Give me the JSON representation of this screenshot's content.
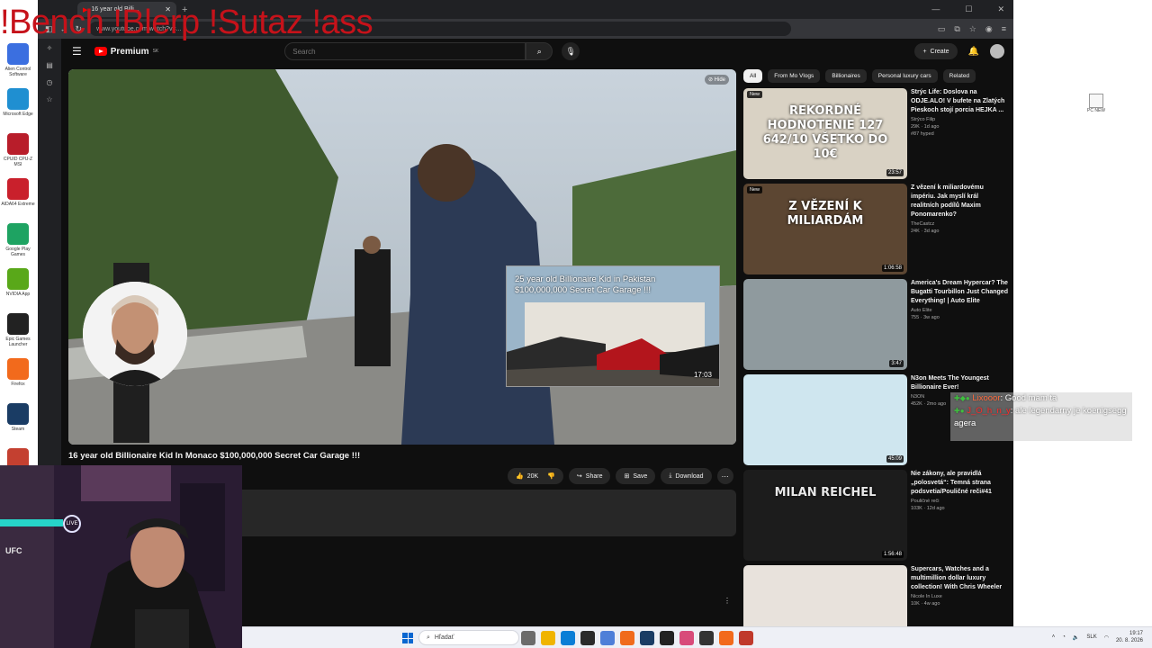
{
  "overlay_text": "!Bench !Blerp !Sutaz !ass",
  "desktop_icons": [
    {
      "label": "Alien Control Software",
      "icon": "app-icon",
      "color": "#3b6fe0"
    },
    {
      "label": "Microsoft Edge",
      "icon": "edge-icon",
      "color": "#1f8fd1"
    },
    {
      "label": "CPUID CPU-Z MSI",
      "icon": "cpuz-icon",
      "color": "#b81d2a"
    },
    {
      "label": "AIDA64 Extreme",
      "icon": "aida64-icon",
      "color": "#c9202c"
    },
    {
      "label": "Google Play Games",
      "icon": "google-play-icon",
      "color": "#1ea362"
    },
    {
      "label": "NVIDIA App",
      "icon": "nvidia-icon",
      "color": "#59a819"
    },
    {
      "label": "Epic Games Launcher",
      "icon": "epic-games-icon",
      "color": "#222222"
    },
    {
      "label": "Firefox",
      "icon": "firefox-icon",
      "color": "#f26a1c"
    },
    {
      "label": "Steam",
      "icon": "steam-icon",
      "color": "#1a3c64"
    },
    {
      "label": "",
      "icon": "app-icon",
      "color": "#c44030"
    }
  ],
  "browser": {
    "tab_title": "16 year old Billi...",
    "url": "www.youtube.com/watch?v=...",
    "new_tab": "+"
  },
  "youtube": {
    "logo_text": "Premium",
    "logo_sup": "SK",
    "search_placeholder": "Search",
    "create_label": "Create",
    "player": {
      "hide_label": "Hide",
      "endcard_title": "25 year old Billionaire Kid in Pakistan $100,000,000 Secret Car Garage !!!",
      "endcard_duration": "17:03"
    },
    "video_title": "16 year old Billionaire Kid In Monaco $100,000,000 Secret Car Garage !!!",
    "actions": {
      "likes": "20K",
      "share": "Share",
      "save": "Save",
      "download": "Download"
    },
    "chips": [
      "All",
      "From Mo Vlogs",
      "Billionaires",
      "Personal luxury cars",
      "Related"
    ],
    "recommendations": [
      {
        "title": "Strýc Life: Doslova na ODJE.ALO! V bufete na Zlatých Pieskoch stojí porcia HEJKA ...",
        "channel": "Strýco Filip",
        "stats": "29K · 1d ago",
        "extra": "#87 hyped",
        "duration": "23:57",
        "new": "New",
        "thumb_text": "REKORDNÉ HODNOTENIE 127 642/10 VŠETKO DO 10€",
        "bg": "#d9d2c4"
      },
      {
        "title": "Z vězení k miliardovému impériu. Jak myslí král realitních podílů Maxim Ponomarenko?",
        "channel": "TheCastcz",
        "stats": "24K · 3d ago",
        "extra": "",
        "duration": "1:06:58",
        "new": "New",
        "thumb_text": "Z VĚZENÍ K MILIARDÁM",
        "bg": "#5c4632"
      },
      {
        "title": "America's Dream Hypercar? The Bugatti Tourbillon Just Changed Everything! | Auto Elite",
        "channel": "Auto Elite",
        "stats": "755 · 3w ago",
        "extra": "",
        "duration": "3:47",
        "new": "",
        "thumb_text": "",
        "bg": "#8f9a9e"
      },
      {
        "title": "N3on Meets The Youngest Billionaire Ever!",
        "channel": "N3ON",
        "stats": "452K · 2mo ago",
        "extra": "",
        "duration": "45:09",
        "new": "",
        "thumb_text": "",
        "bg": "#cfe6ef"
      },
      {
        "title": "Nie zákony, ale pravidlá „polosvetá“: Temná strana podsvetia/Pouličné reči#41",
        "channel": "Pouličné reči",
        "stats": "103K · 12d ago",
        "extra": "",
        "duration": "1:56:48",
        "new": "",
        "thumb_text": "MILAN REICHEL",
        "bg": "#1c1c1c"
      },
      {
        "title": "Supercars, Watches and a multimillion dollar luxury collection! With Chris Wheeler",
        "channel": "Nicole In Luxe",
        "stats": "10K · 4w ago",
        "extra": "",
        "duration": "",
        "new": "",
        "thumb_text": "",
        "bg": "#e8e2dc"
      }
    ]
  },
  "chat": [
    {
      "user": "Lixooor",
      "text": ": Good mam ta"
    },
    {
      "user": "J_O_h_n_y",
      "text": ": ale legendarny je koenigsegg agera"
    }
  ],
  "right_desktop_icon_label": "PC NEW",
  "webcam": {
    "live_label": "LIVE",
    "ufc_label": "UFC"
  },
  "taskbar": {
    "search_placeholder": "Hľadať",
    "language": "SLK",
    "time": "19:17",
    "date": "20. 8. 2026",
    "apps": [
      "#6b6b6b",
      "#f0b400",
      "#0a7ed6",
      "#2a2a2a",
      "#4e7fd8",
      "#f06b1c",
      "#1a3c64",
      "#222",
      "#d84b7a",
      "#333",
      "#f26a1c",
      "#c0392b"
    ]
  }
}
